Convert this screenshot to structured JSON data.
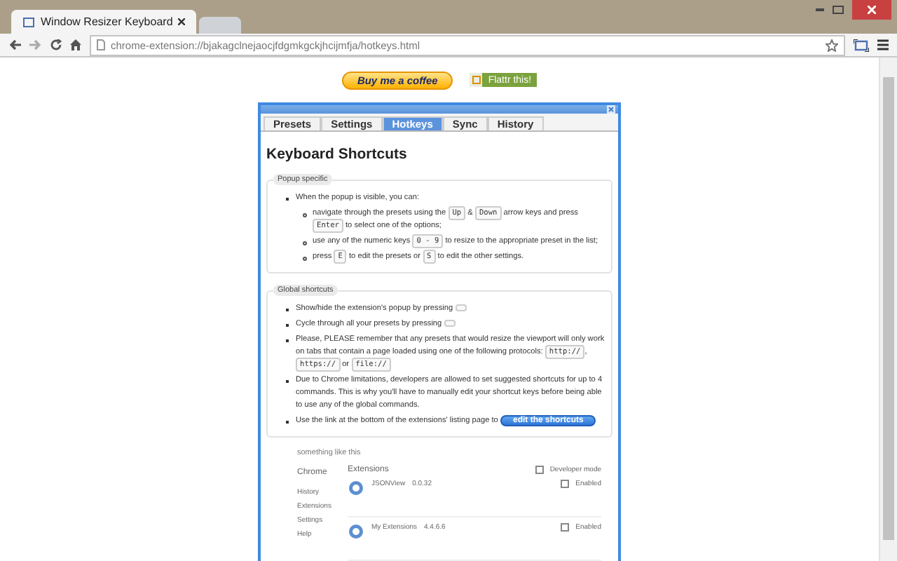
{
  "window": {
    "tabs": [
      {
        "kind": "page",
        "label": "Window Resizer Keyboard",
        "selected": true
      },
      {
        "kind": "new-tab",
        "selected": false
      }
    ]
  },
  "toolbar": {
    "url": "chrome-extension://bjakagclnejaocjfdgmkgckjhcijmfja/hotkeys.html"
  },
  "page": {
    "buttons": [
      {
        "kind": "coffee",
        "label": "Buy me a coffee"
      },
      {
        "kind": "flattr",
        "label": "Flattr this!"
      }
    ]
  },
  "panel": {
    "tabs": [
      {
        "label": "Presets",
        "selected": false
      },
      {
        "label": "Settings",
        "selected": false
      },
      {
        "label": "Hotkeys",
        "selected": true
      },
      {
        "label": "Sync",
        "selected": false
      },
      {
        "label": "History",
        "selected": false
      }
    ],
    "heading": "Keyboard Shortcuts",
    "sections": [
      {
        "legend": "Popup specific",
        "items": [
          {
            "parts": [
              {
                "kind": "text",
                "text": "When the popup is visible, you can:"
              }
            ],
            "children": [
              {
                "parts": [
                  {
                    "kind": "text",
                    "text": "navigate through the presets using the "
                  },
                  {
                    "kind": "key",
                    "text": "Up"
                  },
                  {
                    "kind": "text",
                    "text": " & "
                  },
                  {
                    "kind": "key",
                    "text": "Down"
                  },
                  {
                    "kind": "text",
                    "text": " arrow keys and press "
                  },
                  {
                    "kind": "key",
                    "text": "Enter"
                  },
                  {
                    "kind": "text",
                    "text": " to select one of the options;"
                  }
                ]
              },
              {
                "parts": [
                  {
                    "kind": "text",
                    "text": "use any of the numeric keys "
                  },
                  {
                    "kind": "key",
                    "text": "0 - 9"
                  },
                  {
                    "kind": "text",
                    "text": " to resize to the appropriate preset in the list;"
                  }
                ]
              },
              {
                "parts": [
                  {
                    "kind": "text",
                    "text": "press "
                  },
                  {
                    "kind": "key",
                    "text": "E"
                  },
                  {
                    "kind": "text",
                    "text": " to edit the presets or "
                  },
                  {
                    "kind": "key",
                    "text": "S"
                  },
                  {
                    "kind": "text",
                    "text": " to edit the other settings."
                  }
                ]
              }
            ]
          }
        ]
      },
      {
        "legend": "Global shortcuts",
        "items": [
          {
            "parts": [
              {
                "kind": "text",
                "text": "Show/hide the extension's popup by pressing "
              },
              {
                "kind": "empty-key"
              }
            ]
          },
          {
            "parts": [
              {
                "kind": "text",
                "text": "Cycle through all your presets by pressing "
              },
              {
                "kind": "empty-key"
              }
            ]
          },
          {
            "parts": [
              {
                "kind": "text",
                "text": "Please, PLEASE remember that any presets that would resize the viewport will only work on tabs that contain a page loaded using one of the following protocols: "
              },
              {
                "kind": "key",
                "text": "http://"
              },
              {
                "kind": "text",
                "text": ", "
              },
              {
                "kind": "key",
                "text": "https://"
              },
              {
                "kind": "text",
                "text": " or "
              },
              {
                "kind": "key",
                "text": "file://"
              }
            ]
          },
          {
            "parts": [
              {
                "kind": "text",
                "text": "Due to Chrome limitations, developers are allowed to set suggested shortcuts for up to 4 commands. This is why you'll have to manually edit your shortcut keys before being able to use any of the global commands."
              }
            ]
          },
          {
            "parts": [
              {
                "kind": "text",
                "text": "Use the link at the bottom of the extensions' listing page to "
              },
              {
                "kind": "button",
                "text": "edit the shortcuts"
              }
            ]
          }
        ]
      }
    ],
    "caption": "something like this",
    "screenshot": {
      "nav_title": "Chrome",
      "nav": [
        "History",
        "Extensions",
        "Settings",
        "Help"
      ],
      "title": "Extensions",
      "dev_mode": "Developer mode",
      "extensions": [
        {
          "name": "JSONView",
          "version": "0.0.32",
          "enabled_label": "Enabled"
        },
        {
          "name": "My Extensions",
          "version": "4.4.6.6",
          "enabled_label": "Enabled"
        }
      ]
    }
  }
}
